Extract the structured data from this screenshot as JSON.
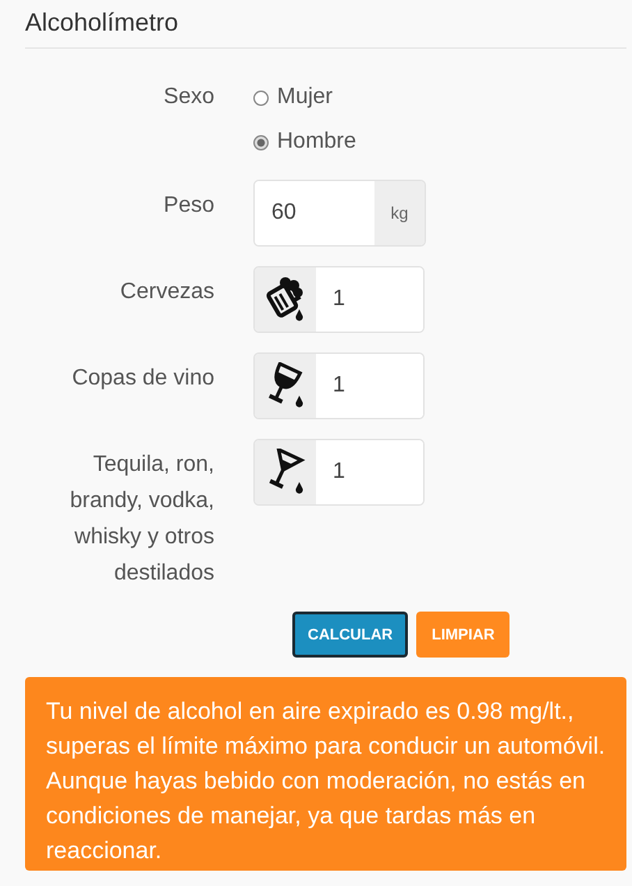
{
  "title": "Alcoholímetro",
  "sex": {
    "label": "Sexo",
    "options": [
      {
        "label": "Mujer",
        "selected": false
      },
      {
        "label": "Hombre",
        "selected": true
      }
    ]
  },
  "weight": {
    "label": "Peso",
    "value": "60",
    "unit": "kg"
  },
  "drinks": [
    {
      "kind": "beer",
      "label": "Cervezas",
      "value": "1"
    },
    {
      "kind": "wine",
      "label": "Copas de vino",
      "value": "1"
    },
    {
      "kind": "spirits",
      "label": "Tequila, ron, brandy, vodka, whisky y otros destilados",
      "value": "1"
    }
  ],
  "buttons": [
    {
      "label": "CALCULAR",
      "kind": "primary",
      "focused": true
    },
    {
      "label": "LIMPIAR",
      "kind": "warning",
      "focused": false
    }
  ],
  "result": {
    "text": "Tu nivel de alcohol en aire expirado es 0.98 mg/lt., superas el límite máximo para conducir un automóvil. Aunque hayas bebido con moderación, no estás en condiciones de manejar, ya que tardas más en reaccionar."
  }
}
